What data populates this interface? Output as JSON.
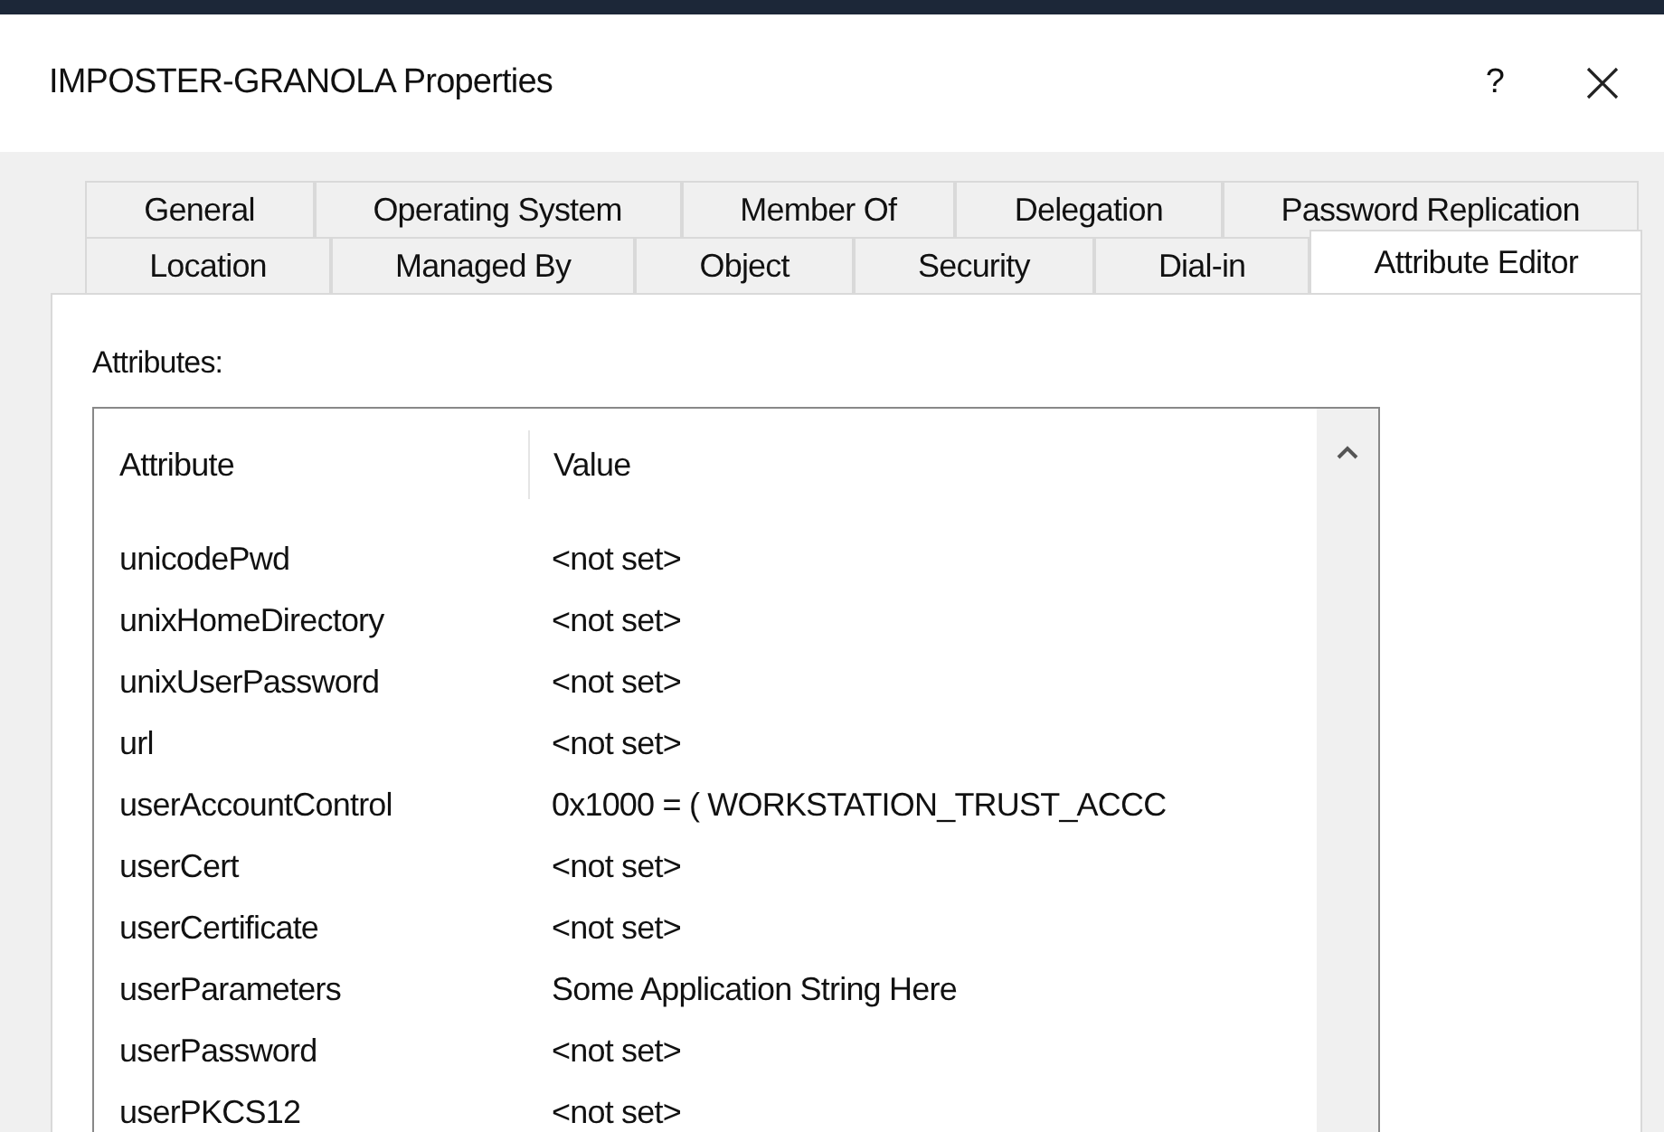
{
  "window": {
    "title": "IMPOSTER-GRANOLA Properties",
    "help": "?"
  },
  "tab_rows": [
    [
      {
        "label": "General",
        "selected": false
      },
      {
        "label": "Operating System",
        "selected": false
      },
      {
        "label": "Member Of",
        "selected": false
      },
      {
        "label": "Delegation",
        "selected": false
      },
      {
        "label": "Password Replication",
        "selected": false
      }
    ],
    [
      {
        "label": "Location",
        "selected": false
      },
      {
        "label": "Managed By",
        "selected": false
      },
      {
        "label": "Object",
        "selected": false
      },
      {
        "label": "Security",
        "selected": false
      },
      {
        "label": "Dial-in",
        "selected": false
      },
      {
        "label": "Attribute Editor",
        "selected": true
      }
    ]
  ],
  "attributes_label": "Attributes:",
  "table": {
    "columns": [
      "Attribute",
      "Value"
    ],
    "rows": [
      [
        "unicodePwd",
        "<not set>"
      ],
      [
        "unixHomeDirectory",
        "<not set>"
      ],
      [
        "unixUserPassword",
        "<not set>"
      ],
      [
        "url",
        "<not set>"
      ],
      [
        "userAccountControl",
        "0x1000 = ( WORKSTATION_TRUST_ACCC"
      ],
      [
        "userCert",
        "<not set>"
      ],
      [
        "userCertificate",
        "<not set>"
      ],
      [
        "userParameters",
        "Some Application String Here"
      ],
      [
        "userPassword",
        "<not set>"
      ],
      [
        "userPKCS12",
        "<not set>"
      ]
    ]
  }
}
